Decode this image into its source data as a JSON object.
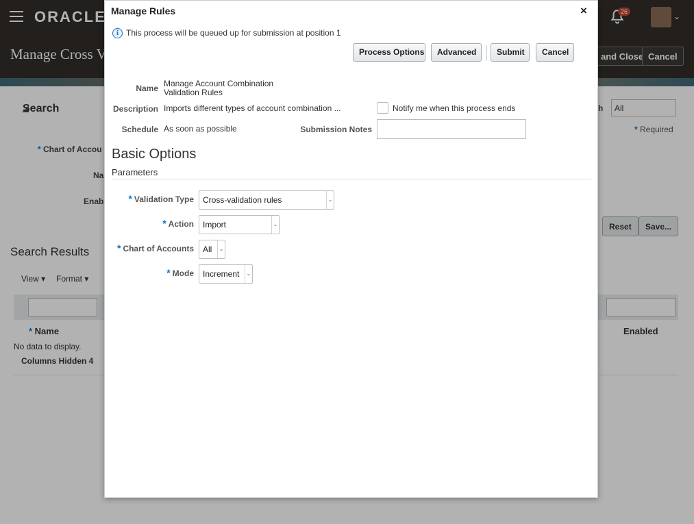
{
  "background": {
    "logo": "ORACLE",
    "notifications_count": "26",
    "page_title": "Manage Cross V",
    "save_close_label": "and Close",
    "cancel_label": "Cancel",
    "search_heading": "Search",
    "match_label": "h",
    "match_value": "All",
    "required_label": "Required",
    "chart_label": "Chart of Accou",
    "name_label": "Na",
    "enabled_label": "Enab",
    "reset_label": "Reset",
    "save_label": "Save...",
    "results_heading": "Search Results",
    "view_label": "View",
    "format_label": "Format",
    "col_name": "Name",
    "col_enabled": "Enabled",
    "no_data": "No data to display.",
    "columns_hidden": "Columns Hidden  4"
  },
  "dialog": {
    "title": "Manage Rules",
    "close_symbol": "×",
    "info_message": "This process will be queued up for submission at position 1",
    "buttons": {
      "process_options": "Process Options",
      "advanced": "Advanced",
      "submit": "Submit",
      "cancel": "Cancel"
    },
    "fields": {
      "name_label": "Name",
      "name_value_line1": "Manage Account Combination",
      "name_value_line2": "Validation Rules",
      "description_label": "Description",
      "description_value": "Imports different types of account combination ...",
      "notify_label": "Notify me when this process ends",
      "schedule_label": "Schedule",
      "schedule_value": "As soon as possible",
      "submission_notes_label": "Submission Notes",
      "submission_notes_value": ""
    },
    "basic_options_title": "Basic Options",
    "parameters_title": "Parameters",
    "parameters": {
      "validation_type_label": "Validation Type",
      "validation_type_value": "Cross-validation rules",
      "action_label": "Action",
      "action_value": "Import",
      "chart_of_accounts_label": "Chart of Accounts",
      "chart_of_accounts_value": "All",
      "mode_label": "Mode",
      "mode_value": "Increment"
    }
  }
}
